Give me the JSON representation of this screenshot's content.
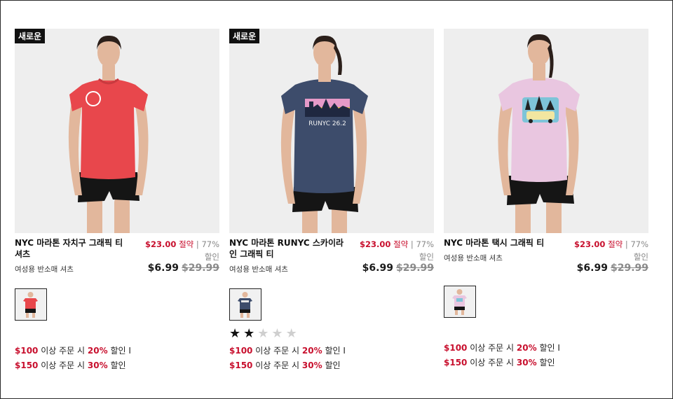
{
  "products": [
    {
      "badge": "새로운",
      "name": "NYC 마라톤 자치구 그래픽 티셔츠",
      "savings_amount": "$23.00",
      "savings_word": "절약",
      "separator": "|",
      "savings_percent": "77%",
      "savings_suffix": "할인",
      "subtitle": "여성용 반소매 셔츠",
      "sale_price": "$6.99",
      "original_price": "$29.99",
      "shirt_color": "#e8474c",
      "promo": {
        "line1_amount": "$100",
        "line1_mid": "이상 주문 시",
        "line1_pct": "20%",
        "line1_tail": "할인 I",
        "line2_amount": "$150",
        "line2_mid": "이상 주문 시",
        "line2_pct": "30%",
        "line2_tail": "할인"
      }
    },
    {
      "badge": "새로운",
      "name": "NYC 마라톤 RUNYC 스카이라인 그래픽 티",
      "savings_amount": "$23.00",
      "savings_word": "절약",
      "separator": "|",
      "savings_percent": "77%",
      "savings_suffix": "할인",
      "subtitle": "여성용 반소매 셔츠",
      "sale_price": "$6.99",
      "original_price": "$29.99",
      "shirt_color": "#3d4c6b",
      "shirt_graphic": "RUNYC 26.2",
      "rating": 2,
      "rating_max": 5,
      "promo": {
        "line1_amount": "$100",
        "line1_mid": "이상 주문 시",
        "line1_pct": "20%",
        "line1_tail": "할인 I",
        "line2_amount": "$150",
        "line2_mid": "이상 주문 시",
        "line2_pct": "30%",
        "line2_tail": "할인"
      }
    },
    {
      "name": "NYC 마라톤 택시 그래픽 티",
      "savings_amount": "$23.00",
      "savings_word": "절약",
      "separator": "|",
      "savings_percent": "77%",
      "savings_suffix": "할인",
      "subtitle": "여성용 반소매 셔츠",
      "sale_price": "$6.99",
      "original_price": "$29.99",
      "shirt_color": "#e9c6e0",
      "promo": {
        "line1_amount": "$100",
        "line1_mid": "이상 주문 시",
        "line1_pct": "20%",
        "line1_tail": "할인 I",
        "line2_amount": "$150",
        "line2_mid": "이상 주문 시",
        "line2_pct": "30%",
        "line2_tail": "할인"
      }
    }
  ],
  "colors": {
    "accent_red": "#c8102e",
    "strike_gray": "#8a8a8a"
  }
}
